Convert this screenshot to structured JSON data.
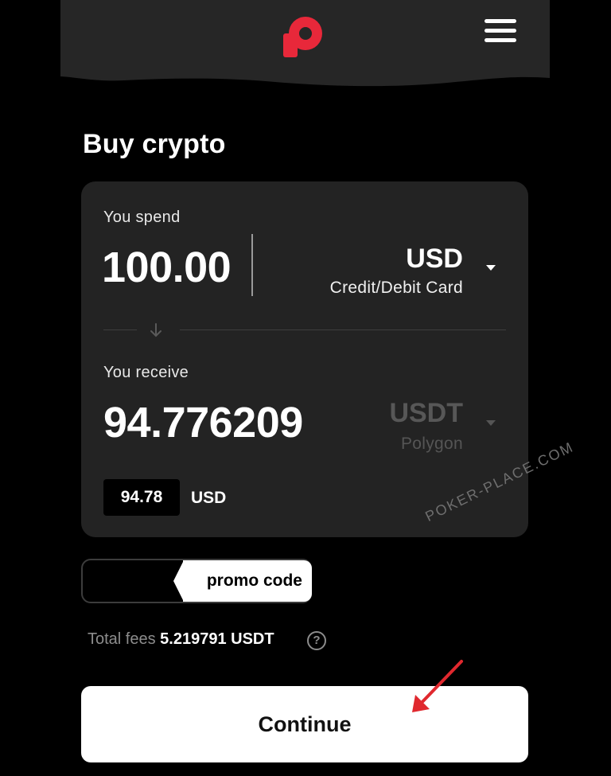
{
  "header": {
    "logo_icon": "brand-p-logo-icon",
    "brand_color": "#e8283a",
    "menu_icon": "hamburger-menu-icon"
  },
  "page": {
    "title": "Buy crypto"
  },
  "spend": {
    "label": "You spend",
    "amount": "100.00",
    "currency": "USD",
    "method": "Credit/Debit Card"
  },
  "receive": {
    "label": "You receive",
    "amount": "94.776209",
    "currency": "USDT",
    "network": "Polygon",
    "usd_value": "94.78",
    "usd_label": "USD"
  },
  "promo": {
    "label": "promo code"
  },
  "fees": {
    "label": "Total fees",
    "value": "5.219791 USDT"
  },
  "continue": {
    "label": "Continue"
  },
  "watermark": {
    "text": "POKER-PLACE.COM"
  },
  "annotation": {
    "arrow_color": "#e0282e"
  }
}
